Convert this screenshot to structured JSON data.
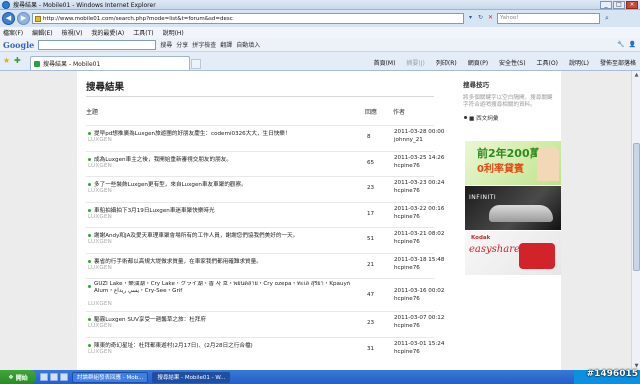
{
  "window": {
    "title": "搜尋結果 - Mobile01 - Windows Internet Explorer"
  },
  "address": {
    "url": "http://www.mobile01.com/search.php?mode=list&t=forum&sd=desc",
    "search_placeholder": "Yahoo!"
  },
  "menu": [
    "檔案(F)",
    "編輯(E)",
    "檢視(V)",
    "我的最愛(A)",
    "工具(T)",
    "說明(H)"
  ],
  "google_toolbar": {
    "logo": "Google",
    "items": [
      "搜尋",
      "分享",
      "拼字檢查",
      "翻譯",
      "自動填入"
    ]
  },
  "tab": {
    "label": "搜尋結果 - Mobile01"
  },
  "commands": [
    "首頁(M)",
    "摘要(J)",
    "列印(R)",
    "網頁(P)",
    "安全性(S)",
    "工具(O)",
    "說明(L)",
    "發佈至部落格"
  ],
  "page": {
    "heading": "搜尋結果",
    "columns": {
      "topic": "主題",
      "replies": "回應",
      "author": "作者"
    },
    "rows": [
      {
        "title": "提早pd想推廣為Luxgen旅遊團的好朋友慶生：codemi0326大大，生日快樂！",
        "forum": "LUXGEN",
        "replies": "8",
        "date": "2011-03-28 00:00",
        "author": "johnny_21"
      },
      {
        "title": "成為Luxgen車主之後，我開始重新審視交朋友的朋友。",
        "forum": "LUXGEN",
        "replies": "65",
        "date": "2011-03-25 14:26",
        "author": "hcpine76"
      },
      {
        "title": "多了一些裝飾Luxgen更有型，來自Luxgen車友車聚的觀察。",
        "forum": "LUXGEN",
        "replies": "23",
        "date": "2011-03-23 00:24",
        "author": "hcpine76"
      },
      {
        "title": "車船拍攝拍下3月19日Luxgen車迷車聚快樂時光",
        "forum": "LUXGEN",
        "replies": "17",
        "date": "2011-03-22 00:16",
        "author": "hcpine76"
      },
      {
        "title": "謝謝Andy和JA及愛天車理車聚會場所有的工作人員，謝謝您們協我們美好的一天。",
        "forum": "LUXGEN",
        "replies": "51",
        "date": "2011-03-21 08:02",
        "author": "hcpine76"
      },
      {
        "title": "裏省的行手術都以高規大堤做求質量，在車家我們都用確難求質量。",
        "forum": "LUXGEN",
        "replies": "21",
        "date": "2011-03-18 15:48",
        "author": "hcpine76"
      },
      {
        "title": "GUZI Lake・樂油湖・Cry Lake・クライ湖・香 자 호・พยนตล่าย・Cry ozepa・ทะเล สุริยา・Kpauyń Alum・يسي ريداع・Cry-See・Grif",
        "forum": "LUXGEN",
        "replies": "47",
        "date": "2011-03-16 00:02",
        "author": "hcpine76"
      },
      {
        "title": "驅霧Luxgen SUV享受一趟馨草之旅：杜拜府",
        "forum": "LUXGEN",
        "replies": "23",
        "date": "2011-03-07 00:12",
        "author": "hcpine76"
      },
      {
        "title": "陳東的奇幻星址：杜拜都東遊村(2月17日)、(2月28日之行合檔)",
        "forum": "LUXGEN",
        "replies": "31",
        "date": "2011-03-01 15:24",
        "author": "hcpine76"
      }
    ]
  },
  "sidebar": {
    "title": "搜尋技巧",
    "text": "將多個關鍵字以空白隔開，搜尋關鍵字符合遊哨搜尋相關的資料。",
    "link": "■ 西文詞彙",
    "ads": {
      "ad1_big": "前2年200萬",
      "ad1_sub": "0利率貸賓",
      "ad2_brand": "INFINITI",
      "ad3_logo": "Kodak",
      "ad3_text": "easyshare"
    }
  },
  "taskbar": {
    "start": "開始",
    "tasks": [
      "討論群組發表回應 - Mob...",
      "搜尋結果 - Mobile01 - W..."
    ]
  },
  "watermark": "#1496015"
}
